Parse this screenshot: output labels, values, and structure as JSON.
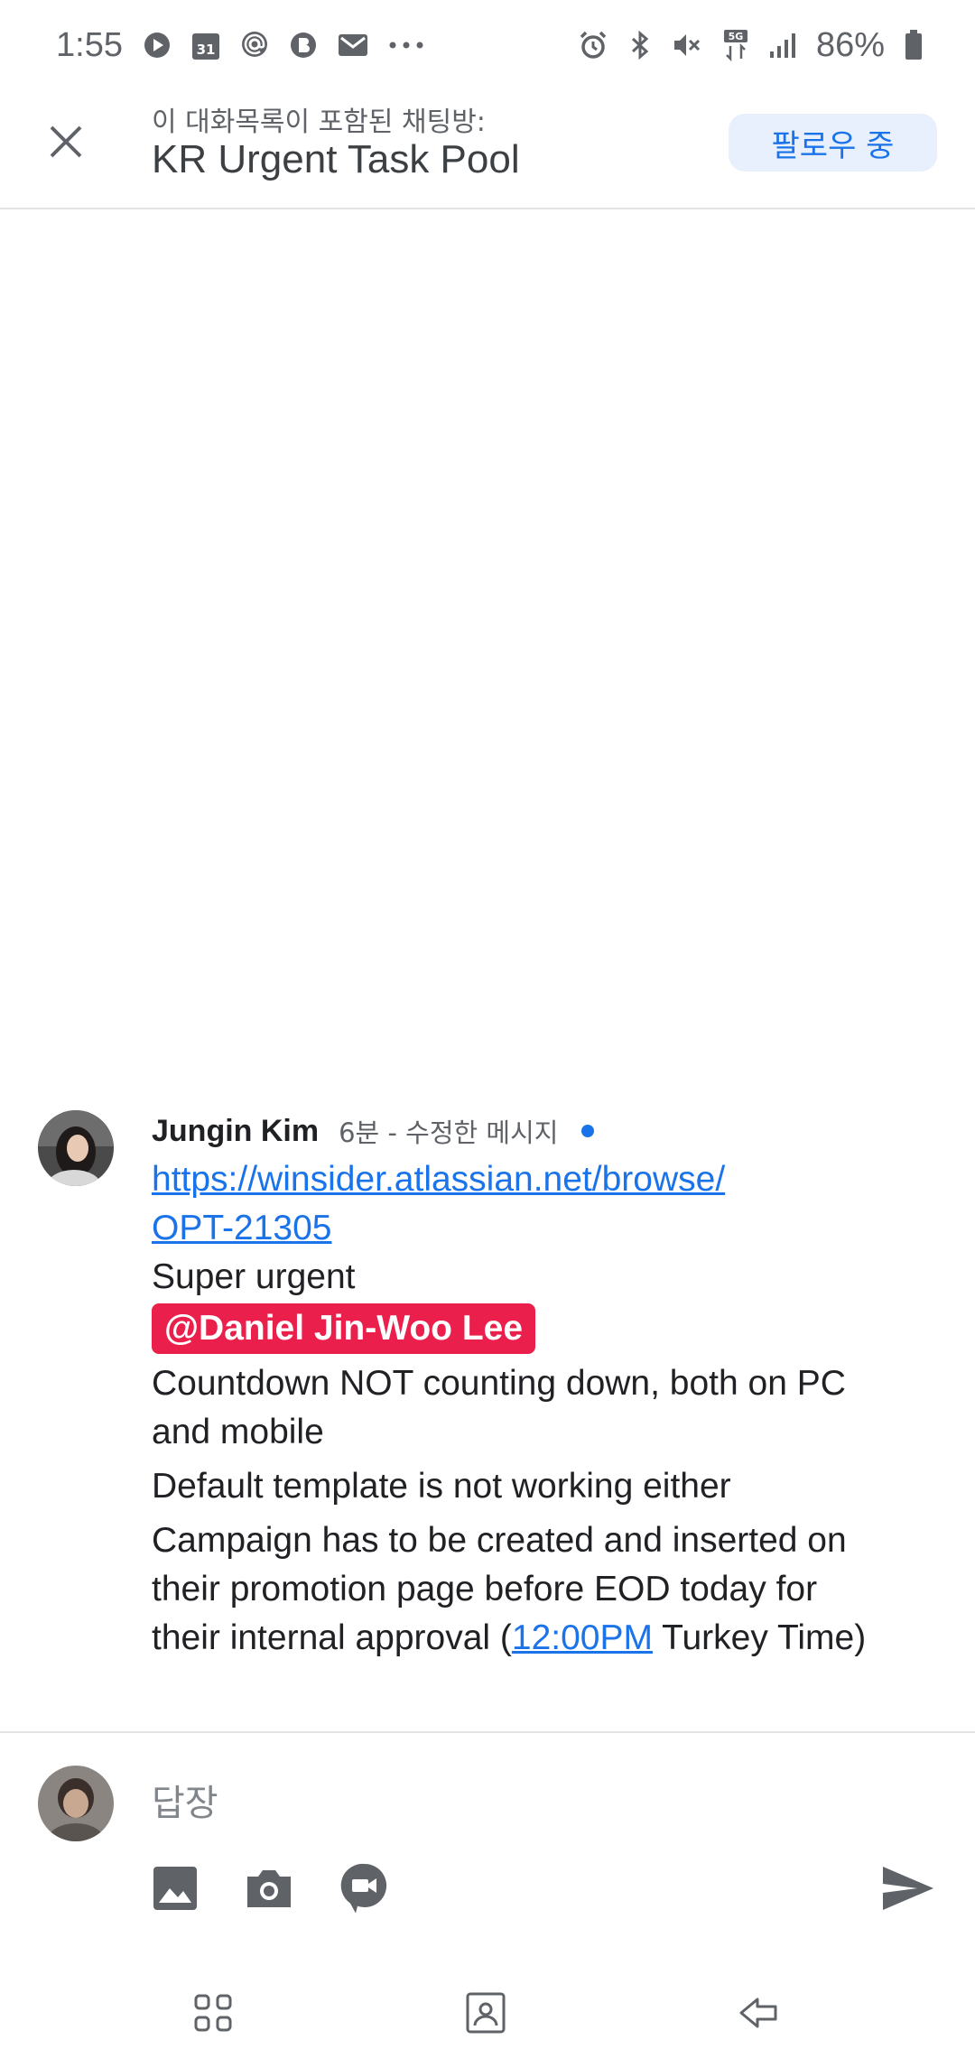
{
  "status_bar": {
    "time": "1:55",
    "icons_left": [
      "play-icon",
      "calendar-icon",
      "at-icon",
      "b-app-icon",
      "gmail-icon",
      "more-icon"
    ],
    "calendar_day": "31",
    "icons_right": [
      "alarm-icon",
      "bluetooth-icon",
      "mute-icon",
      "5g-icon",
      "signal-icon",
      "battery-icon"
    ],
    "network": "5G",
    "battery_percent": "86%"
  },
  "header": {
    "subtitle": "이 대화목록이 포함된 채팅방:",
    "title": "KR Urgent Task Pool",
    "follow_label": "팔로우 중",
    "accent": "#1a73e8",
    "follow_bg": "#e8f0fe"
  },
  "message": {
    "sender": "Jungin Kim",
    "meta": "6분 - 수정한 메시지",
    "link_line1": "https://winsider.atlassian.net/browse/",
    "link_line2": "OPT-21305",
    "line_urgent": "Super urgent",
    "mention": "@Daniel Jin-Woo Lee",
    "mention_color": "#ea1f4b",
    "line_countdown_1": "Countdown NOT counting down, both on PC",
    "line_countdown_2": "and mobile",
    "line_template": "Default template is not working either",
    "line_campaign_1": "Campaign has to be created and inserted on",
    "line_campaign_2": "their promotion page before EOD today for",
    "line_campaign_3_pre": "their internal approval (",
    "line_campaign_3_link": "12:00PM",
    "line_campaign_3_post": " Turkey Time)"
  },
  "reply": {
    "placeholder": "답장",
    "tools": [
      "image-icon",
      "camera-icon",
      "video-meet-icon"
    ],
    "send": "send-icon"
  },
  "nav": [
    "recents-icon",
    "home-icon",
    "back-icon"
  ]
}
